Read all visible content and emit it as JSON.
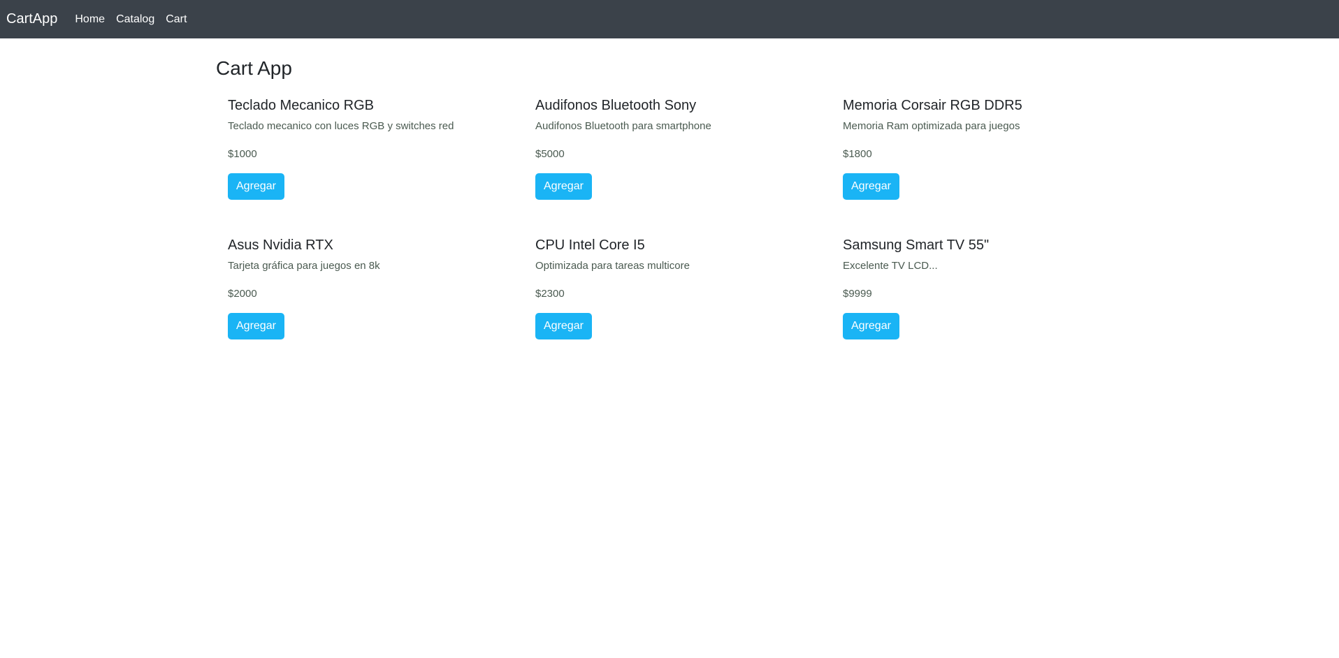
{
  "navbar": {
    "brand": "CartApp",
    "links": [
      "Home",
      "Catalog",
      "Cart"
    ]
  },
  "page": {
    "title": "Cart App"
  },
  "products": [
    {
      "name": "Teclado Mecanico RGB",
      "description": "Teclado mecanico con luces RGB y switches red",
      "price": "$1000",
      "button": "Agregar"
    },
    {
      "name": "Audifonos Bluetooth Sony",
      "description": "Audifonos Bluetooth para smartphone",
      "price": "$5000",
      "button": "Agregar"
    },
    {
      "name": "Memoria Corsair RGB DDR5",
      "description": "Memoria Ram optimizada para juegos",
      "price": "$1800",
      "button": "Agregar"
    },
    {
      "name": "Asus Nvidia RTX",
      "description": "Tarjeta gráfica para juegos en 8k",
      "price": "$2000",
      "button": "Agregar"
    },
    {
      "name": "CPU Intel Core I5",
      "description": "Optimizada para tareas multicore",
      "price": "$2300",
      "button": "Agregar"
    },
    {
      "name": "Samsung Smart TV 55\"",
      "description": "Excelente TV LCD...",
      "price": "$9999",
      "button": "Agregar"
    }
  ],
  "colors": {
    "navbar_bg": "#3b424a",
    "button_bg": "#1ab4f5"
  }
}
